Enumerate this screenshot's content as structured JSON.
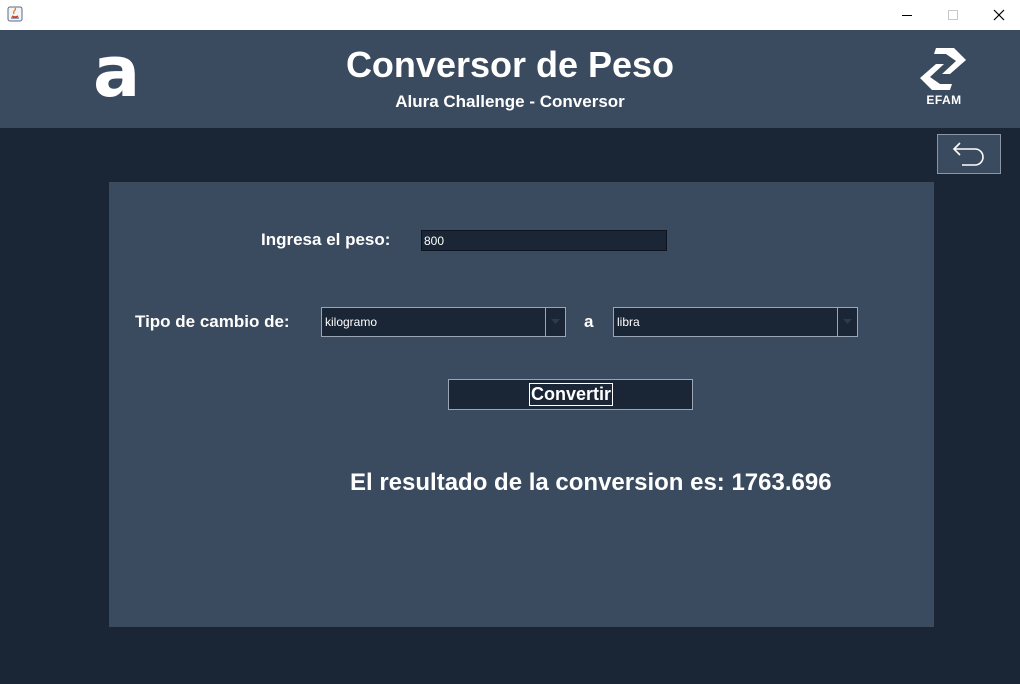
{
  "header": {
    "title": "Conversor de Peso",
    "subtitle": "Alura Challenge - Conversor",
    "logo_left": "a",
    "logo_right": "EFAM"
  },
  "form": {
    "peso_label": "Ingresa el peso:",
    "peso_value": "800",
    "tipo_label": "Tipo de cambio de:",
    "from_unit": "kilogramo",
    "connector": "a",
    "to_unit": "libra",
    "convert_label": "Convertir"
  },
  "result": {
    "text": "El resultado de la conversion es: 1763.696"
  },
  "icons": {
    "app": "java-icon",
    "back": "back-arrow-icon",
    "minimize": "minimize-icon",
    "maximize": "maximize-icon",
    "close": "close-icon",
    "dropdown": "chevron-down-icon"
  },
  "colors": {
    "background": "#1a2636",
    "header": "#3a4a5f",
    "panel": "#3a4a5f",
    "text": "#ffffff"
  }
}
